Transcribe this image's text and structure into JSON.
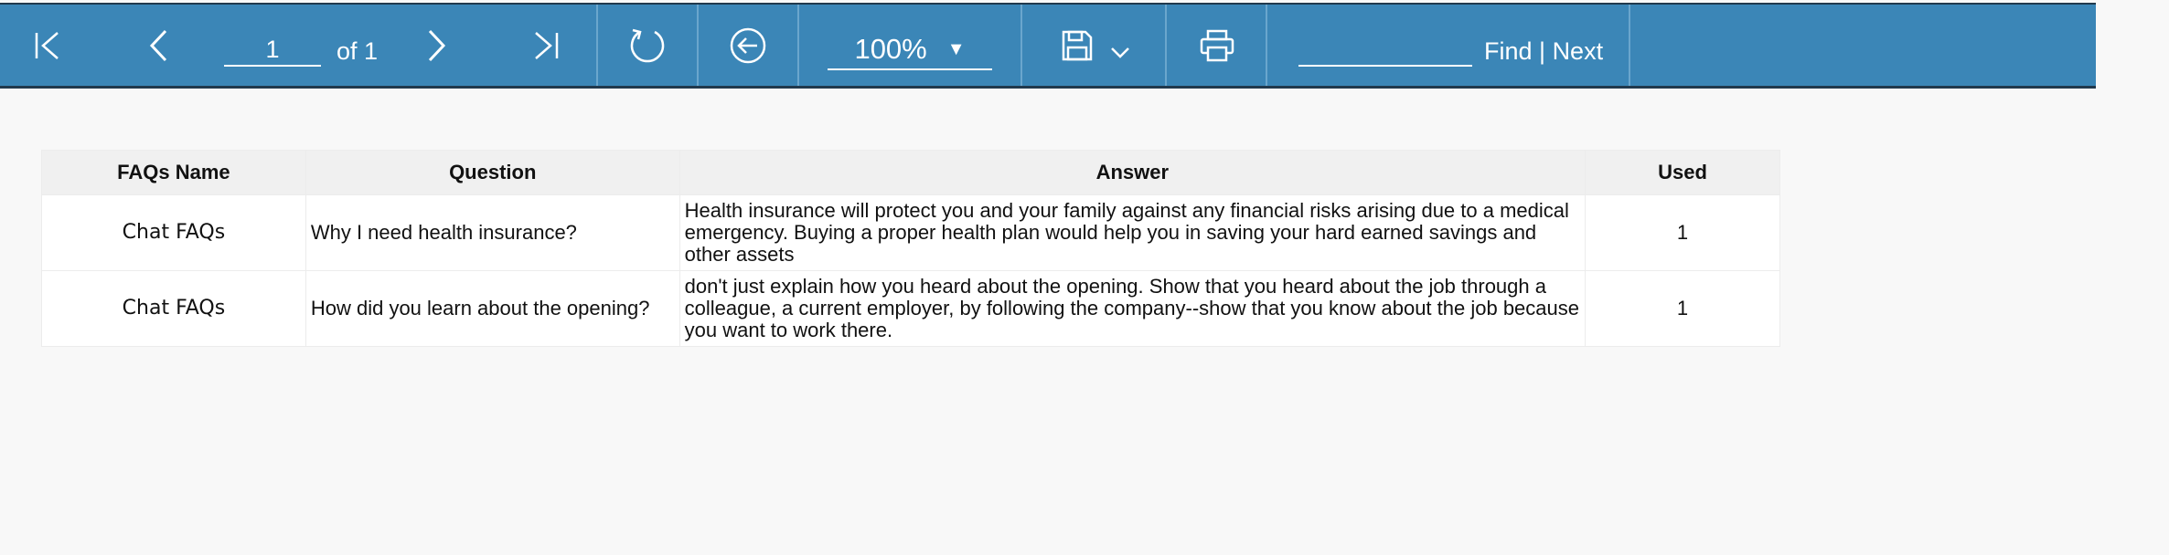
{
  "toolbar": {
    "page_current": "1",
    "page_of": "of 1",
    "zoom": "100%",
    "zoom_arrow": "▼",
    "find_label": "Find",
    "find_sep": " | ",
    "next_label": "Next",
    "accent_color": "#3b86b7",
    "icons": [
      "first-page-icon",
      "prev-page-icon",
      "next-page-icon",
      "last-page-icon",
      "refresh-icon",
      "back-icon",
      "save-icon",
      "chevron-down-icon",
      "print-icon"
    ]
  },
  "table": {
    "headers": [
      "FAQs Name",
      "Question",
      "Answer",
      "Used"
    ],
    "rows": [
      {
        "name": "Chat FAQs",
        "question": "Why I need health insurance?",
        "answer": "Health insurance will protect you and your family against any financial risks arising due to a medical emergency. Buying a proper health plan would help you in saving your hard earned savings and other assets",
        "used": "1"
      },
      {
        "name": "Chat FAQs",
        "question": "How did you learn about the opening?",
        "answer": "don't just explain how you heard about the opening. Show that you heard about the job through a colleague, a current employer, by following the company--show that you know about the job because you want to work there.",
        "used": "1"
      }
    ]
  }
}
